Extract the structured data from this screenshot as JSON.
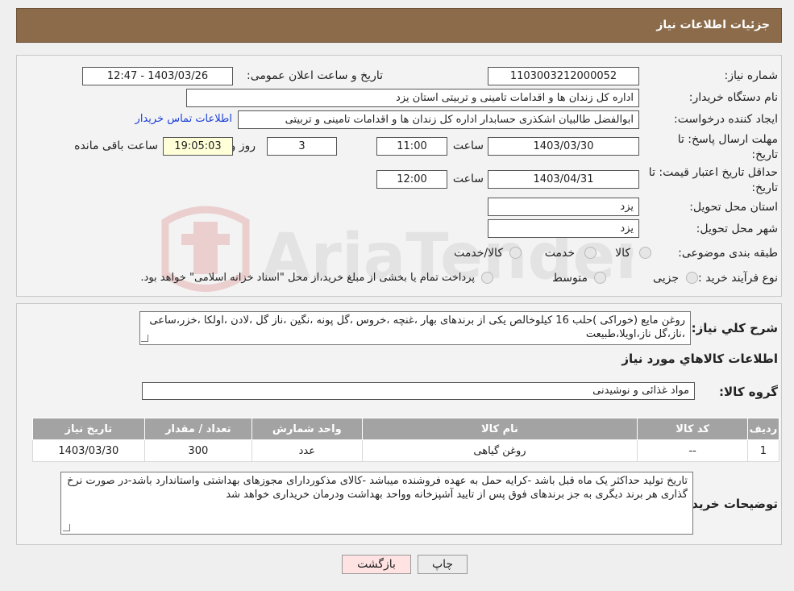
{
  "header": {
    "title": "جزئیات اطلاعات نیاز"
  },
  "form": {
    "need_number": {
      "label": "شماره نیاز:",
      "value": "1103003212000052"
    },
    "announce_datetime": {
      "label": "تاریخ و ساعت اعلان عمومی:",
      "value": "1403/03/26 - 12:47"
    },
    "buyer_org": {
      "label": "نام دستگاه خریدار:",
      "value": "اداره کل زندان ها و اقدامات تامینی و تربیتی استان یزد"
    },
    "requester": {
      "label": "ایجاد کننده درخواست:",
      "value": "ابوالفضل  طالبیان اشکذری حسابدار اداره کل زندان ها و اقدامات تامینی و تربیتی",
      "link": "اطلاعات تماس خریدار"
    },
    "reply_deadline": {
      "label": "مهلت ارسال پاسخ: تا تاریخ:",
      "date": "1403/03/30",
      "time_label": "ساعت",
      "time": "11:00",
      "days": "3",
      "days_label": "روز و",
      "remaining": "19:05:03",
      "remaining_label": "ساعت باقی مانده"
    },
    "price_validity": {
      "label": "حداقل تاریخ اعتبار قیمت: تا تاریخ:",
      "date": "1403/04/31",
      "time_label": "ساعت",
      "time": "12:00"
    },
    "province": {
      "label": "استان محل تحویل:",
      "value": "یزد"
    },
    "city": {
      "label": "شهر محل تحویل:",
      "value": "یزد"
    },
    "category": {
      "label": "طبقه بندی موضوعی:",
      "options": [
        "کالا",
        "خدمت",
        "کالا/خدمت"
      ]
    },
    "process": {
      "label": "نوع فرآیند خرید :",
      "options": [
        "جزیی",
        "متوسط"
      ],
      "note": "پرداخت تمام یا بخشی از مبلغ خرید،از محل \"اسناد خزانه اسلامی\" خواهد بود."
    }
  },
  "watermark": {
    "text": "AriaTender.neT"
  },
  "summary": {
    "label": "شرح کلي نياز:",
    "text": "روغن مایع (خوراکی )حلب 16 کیلوخالص یکی از برندهای بهار ،غنچه ،خروس ،گل پونه ،نگین ،ناز گل ،لادن ،اولکا ،خزر،ساعی ،ناز،گل ناز،اویلا،طبیعت"
  },
  "goods_section": {
    "title": "اطلاعات کالاهاي مورد نياز"
  },
  "goods_group": {
    "label": "گروه کالا:",
    "value": "مواد غذائی و نوشیدنی"
  },
  "table": {
    "headers": [
      "رديف",
      "کد کالا",
      "نام کالا",
      "واحد شمارش",
      "تعداد / مقدار",
      "تاریخ نیاز"
    ],
    "rows": [
      [
        "1",
        "--",
        "روغن گیاهی",
        "عدد",
        "300",
        "1403/03/30"
      ]
    ]
  },
  "buyer_notes": {
    "label": "توضیحات خریدار:",
    "text": "تاریخ تولید حداکثر یک ماه قبل باشد -کرایه حمل به عهده فروشنده میباشد -کالای مذکوردارای مجوزهای بهداشتی واستاندارد باشد-در صورت نرخ گذاری هر برند دیگری به جز برندهای فوق پس از تایید آشپزخانه وواحد بهداشت ودرمان خریداری خواهد شد"
  },
  "buttons": {
    "print": "چاپ",
    "back": "بازگشت"
  }
}
